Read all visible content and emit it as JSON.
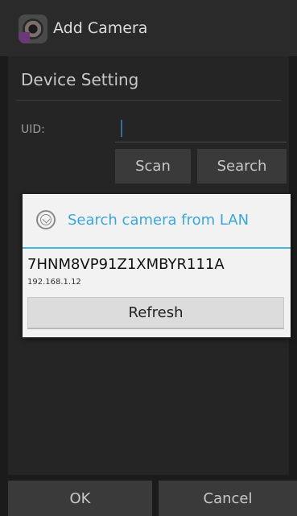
{
  "titlebar": {
    "title": "Add Camera",
    "icon": "camera-app-icon"
  },
  "panel": {
    "title": "Device Setting",
    "uid_label": "UID:",
    "uid_value": "",
    "scan_label": "Scan",
    "search_label": "Search"
  },
  "footer": {
    "ok_label": "OK",
    "cancel_label": "Cancel"
  },
  "dialog": {
    "title": "Search camera from LAN",
    "icon": "search-lan-icon",
    "accent": "#3aa7d9",
    "devices": [
      {
        "uid": "7HNM8VP91Z1XMBYR111A",
        "ip": "192.168.1.12"
      }
    ],
    "refresh_label": "Refresh"
  }
}
